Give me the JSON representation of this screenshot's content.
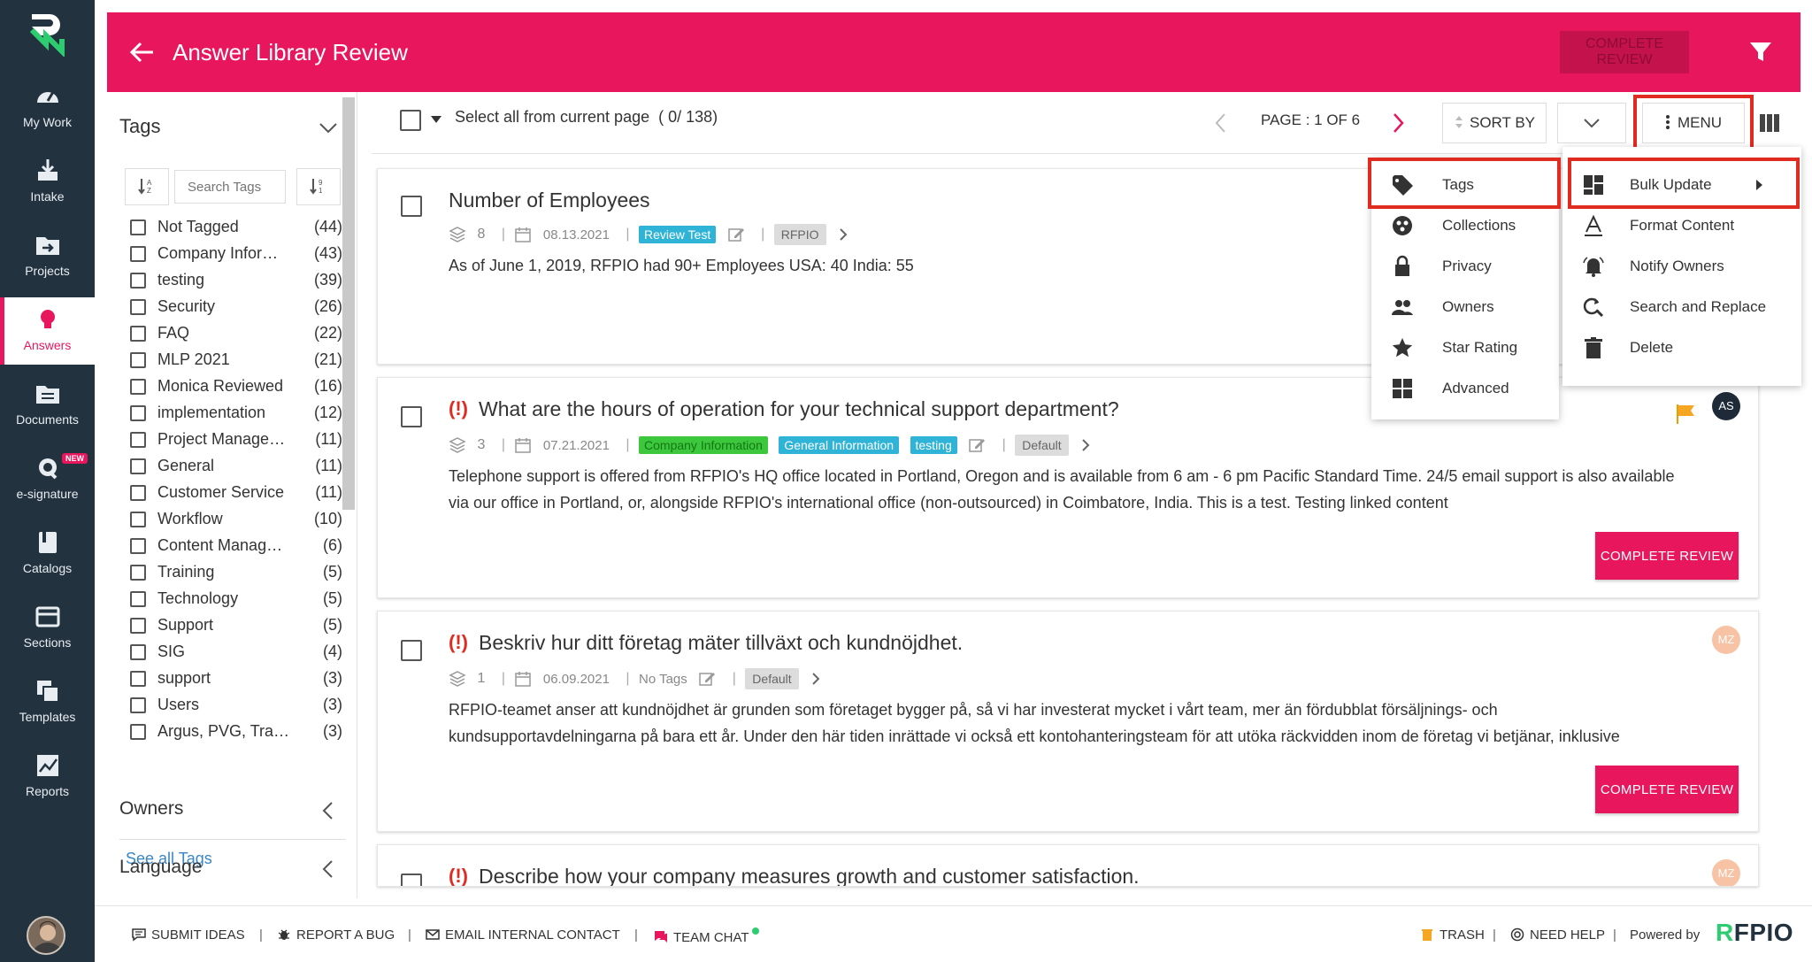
{
  "nav": {
    "items": [
      {
        "label": "My Work",
        "icon": "speedometer-icon"
      },
      {
        "label": "Intake",
        "icon": "download-tray-icon"
      },
      {
        "label": "Projects",
        "icon": "folder-arrow-icon"
      },
      {
        "label": "Answers",
        "icon": "lightbulb-icon"
      },
      {
        "label": "Documents",
        "icon": "folder-docs-icon"
      },
      {
        "label": "e-signature",
        "icon": "signature-icon",
        "badge": "NEW"
      },
      {
        "label": "Catalogs",
        "icon": "book-icon"
      },
      {
        "label": "Sections",
        "icon": "section-icon"
      },
      {
        "label": "Templates",
        "icon": "template-icon"
      },
      {
        "label": "Reports",
        "icon": "chart-icon"
      }
    ]
  },
  "header": {
    "title": "Answer Library Review",
    "complete_review": "COMPLETE REVIEW",
    "accent": "#e8175d"
  },
  "sidebar": {
    "title": "Tags",
    "search_placeholder": "Search Tags",
    "tags": [
      {
        "name": "Not Tagged",
        "count": "(44)"
      },
      {
        "name": "Company Information",
        "count": "(43)"
      },
      {
        "name": "testing",
        "count": "(39)"
      },
      {
        "name": "Security",
        "count": "(26)"
      },
      {
        "name": "FAQ",
        "count": "(22)"
      },
      {
        "name": "MLP 2021",
        "count": "(21)"
      },
      {
        "name": "Monica Reviewed",
        "count": "(16)"
      },
      {
        "name": "implementation",
        "count": "(12)"
      },
      {
        "name": "Project Management",
        "count": "(11)"
      },
      {
        "name": "General",
        "count": "(11)"
      },
      {
        "name": "Customer Service",
        "count": "(11)"
      },
      {
        "name": "Workflow",
        "count": "(10)"
      },
      {
        "name": "Content Management",
        "count": "(6)"
      },
      {
        "name": "Training",
        "count": "(5)"
      },
      {
        "name": "Technology",
        "count": "(5)"
      },
      {
        "name": "Support",
        "count": "(5)"
      },
      {
        "name": "SIG",
        "count": "(4)"
      },
      {
        "name": "support",
        "count": "(3)"
      },
      {
        "name": "Users",
        "count": "(3)"
      },
      {
        "name": "Argus, PVG, Training",
        "count": "(3)"
      }
    ],
    "see_all": "See all Tags",
    "owners": "Owners",
    "language": "Language"
  },
  "toolbar": {
    "select_all": "Select all from current page",
    "selected_count": "( 0/ 138)",
    "page_label": "PAGE : 1 OF 6",
    "sort_by": "SORT BY",
    "menu": "MENU"
  },
  "cards": [
    {
      "question": "Number of Employees",
      "usage": "8",
      "date": "08.13.2021",
      "tags": [
        "Review Test"
      ],
      "owner_tag": "RFPIO",
      "answer": "As of June 1, 2019, RFPIO had 90+ Employees USA: 40 India: 55"
    },
    {
      "flag": "(!)",
      "question": "What are the hours of operation for your technical support department?",
      "usage": "3",
      "date": "07.21.2021",
      "tags": [
        "Company Information",
        "General Information",
        "testing"
      ],
      "owner_tag": "Default",
      "answer_line1": "Telephone support is offered from RFPIO's HQ office located in Portland, Oregon and is available from 6 am - 6 pm Pacific Standard Time. 24/5 email support is also available",
      "answer_line2": "via our office in Portland, or, alongside RFPIO's international office (non-outsourced) in Coimbatore, India. This is a test. Testing linked content",
      "avatar": "AS",
      "complete_review": "COMPLETE REVIEW"
    },
    {
      "flag": "(!)",
      "question": "Beskriv hur ditt företag mäter tillväxt och kundnöjdhet.",
      "usage": "1",
      "date": "06.09.2021",
      "no_tags": "No Tags",
      "owner_tag": "Default",
      "answer_line1": "RFPIO-teamet anser att kundnöjdhet är grunden som företaget bygger på, så vi har investerat mycket i vårt team, mer än fördubblat försäljnings- och",
      "answer_line2": "kundsupportavdelningarna på bara ett år. Under den här tiden inrättade vi också ett kontohanteringsteam för att utöka räckvidden inom de företag vi betjänar, inklusive",
      "avatar": "MZ",
      "complete_review": "COMPLETE REVIEW"
    },
    {
      "flag": "(!)",
      "question": "Describe how your company measures growth and customer satisfaction.",
      "avatar": "MZ"
    }
  ],
  "menu_left": [
    {
      "label": "Tags",
      "icon": "tag-icon"
    },
    {
      "label": "Collections",
      "icon": "collections-icon"
    },
    {
      "label": "Privacy",
      "icon": "lock-icon"
    },
    {
      "label": "Owners",
      "icon": "people-icon"
    },
    {
      "label": "Star Rating",
      "icon": "star-icon"
    },
    {
      "label": "Advanced",
      "icon": "grid-icon"
    }
  ],
  "menu_right": [
    {
      "label": "Bulk Update",
      "icon": "dashboard-icon"
    },
    {
      "label": "Format Content",
      "icon": "format-text-icon"
    },
    {
      "label": "Notify Owners",
      "icon": "bell-icon"
    },
    {
      "label": "Search and Replace",
      "icon": "search-replace-icon"
    },
    {
      "label": "Delete",
      "icon": "trash-icon"
    }
  ],
  "footer": {
    "submit_ideas": "SUBMIT IDEAS",
    "report_bug": "REPORT A BUG",
    "email_contact": "EMAIL INTERNAL CONTACT",
    "team_chat": "TEAM CHAT",
    "trash": "TRASH",
    "need_help": "NEED HELP",
    "powered_by": "Powered by",
    "brand_r": "R",
    "brand_rest": "FPIO"
  }
}
